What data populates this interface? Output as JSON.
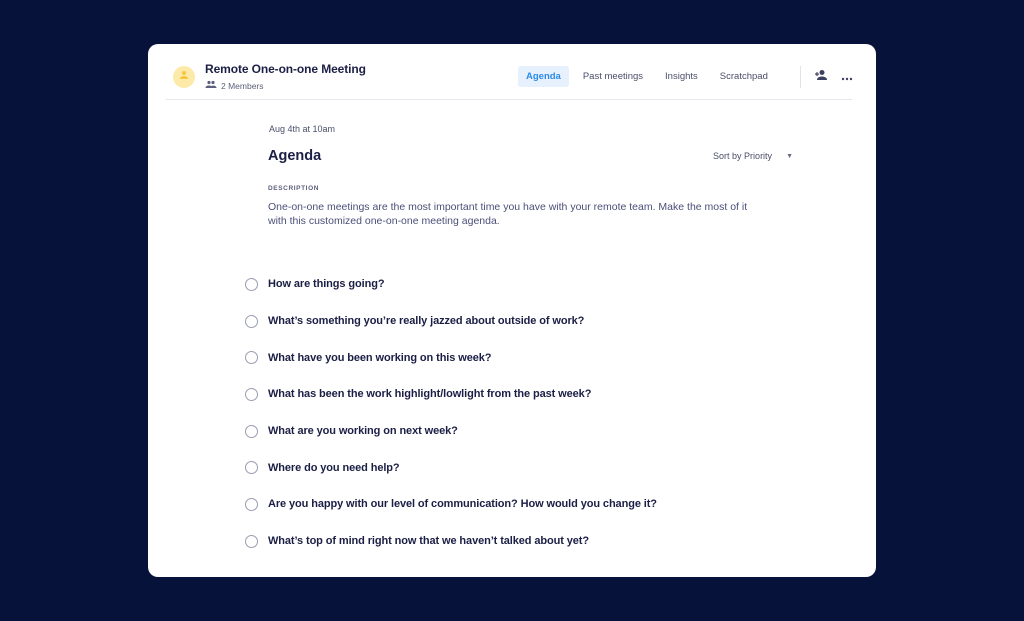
{
  "header": {
    "title": "Remote One-on-one Meeting",
    "members_label": "2 Members",
    "avatar_icon": "person-icon",
    "members_icon": "people-icon"
  },
  "tabs": [
    {
      "label": "Agenda",
      "active": true
    },
    {
      "label": "Past meetings",
      "active": false
    },
    {
      "label": "Insights",
      "active": false
    },
    {
      "label": "Scratchpad",
      "active": false
    }
  ],
  "actions": {
    "add_member_icon": "person-add-icon",
    "more_icon": "more-horizontal-icon"
  },
  "meeting": {
    "date": "Aug 4th at 10am",
    "section_title": "Agenda",
    "sort_label": "Sort by Priority",
    "description_label": "DESCRIPTION",
    "description": "One-on-one meetings are the most important time you have with your remote team. Make the most of it with this customized one-on-one meeting agenda."
  },
  "agenda_items": [
    {
      "text": "How are things going?",
      "checked": false
    },
    {
      "text": "What’s something you’re really jazzed about outside of work?",
      "checked": false
    },
    {
      "text": "What have you been working on this week?",
      "checked": false
    },
    {
      "text": "What has been the work highlight/lowlight from the past week?",
      "checked": false
    },
    {
      "text": "What are you working on next week?",
      "checked": false
    },
    {
      "text": "Where do you need help?",
      "checked": false
    },
    {
      "text": "Are you happy with our level of communication? How would you change it?",
      "checked": false
    },
    {
      "text": "What’s top of mind right now that we haven’t talked about yet?",
      "checked": false
    }
  ],
  "colors": {
    "background": "#06123a",
    "accent": "#2b8be6",
    "accent_bg": "#e6f1fd",
    "avatar_bg": "#fde9a8",
    "text_primary": "#1b1f45"
  }
}
